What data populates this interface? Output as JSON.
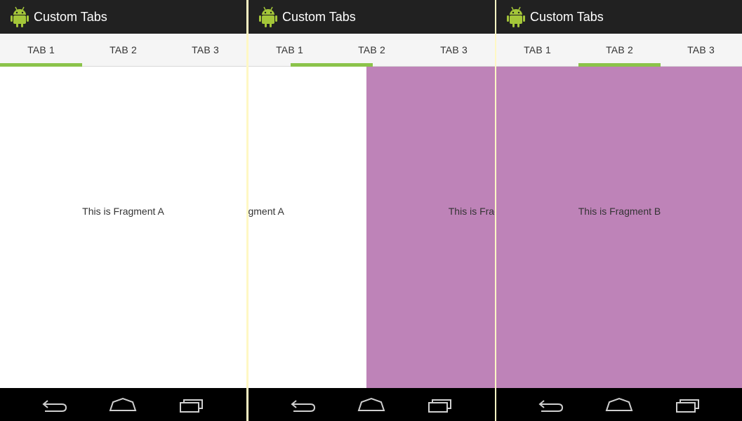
{
  "app": {
    "title": "Custom Tabs",
    "logo_icon": "android-robot-icon",
    "accent_color": "#8bc34a"
  },
  "tabs": [
    {
      "label": "TAB 1"
    },
    {
      "label": "TAB 2"
    },
    {
      "label": "TAB 3"
    }
  ],
  "fragments": {
    "a": {
      "text": "This is Fragment A",
      "background": "#ffffff"
    },
    "b": {
      "text": "This is Fragment B",
      "background": "#be83b8"
    }
  },
  "navbar": {
    "icons": [
      "back-icon",
      "home-icon",
      "recents-icon"
    ]
  }
}
